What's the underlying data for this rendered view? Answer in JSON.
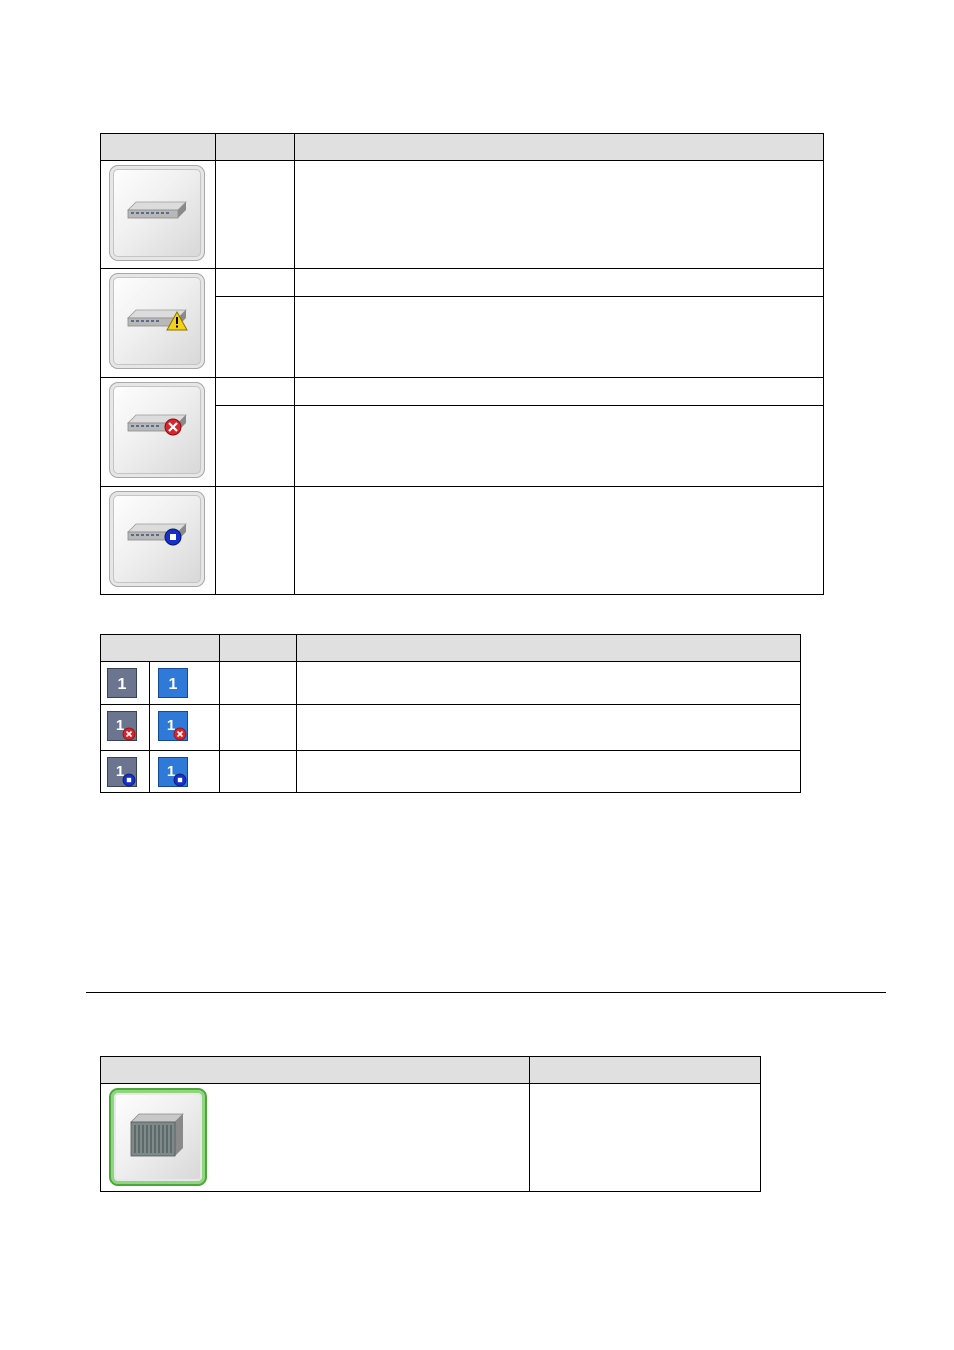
{
  "device_status_table": {
    "columns": [
      "",
      "",
      ""
    ],
    "rows": [
      {
        "icon": "switch-normal-icon",
        "status": "",
        "description": ""
      },
      {
        "icon": "switch-warning-icon",
        "status_a": "",
        "description_a": "",
        "status_b": "",
        "description_b": ""
      },
      {
        "icon": "switch-error-icon",
        "status_a": "",
        "description_a": "",
        "status_b": "",
        "description_b": ""
      },
      {
        "icon": "switch-maintenance-icon",
        "status": "",
        "description": ""
      }
    ]
  },
  "port_status_table": {
    "columns": [
      "",
      "",
      ""
    ],
    "port_label": "1",
    "rows": [
      {
        "icons": [
          "port-gray-icon",
          "port-blue-icon"
        ],
        "status": "",
        "description": ""
      },
      {
        "icons": [
          "port-gray-error-icon",
          "port-blue-error-icon"
        ],
        "status": "",
        "description": ""
      },
      {
        "icons": [
          "port-gray-maintenance-icon",
          "port-blue-maintenance-icon"
        ],
        "status": "",
        "description": ""
      }
    ]
  },
  "storage_table": {
    "columns": [
      "",
      ""
    ],
    "rows": [
      {
        "icon": "storage-array-icon",
        "description": ""
      }
    ]
  },
  "colors": {
    "header_bg": "#e0e0e0",
    "warning_yellow": "#f2d21b",
    "error_red": "#d8242b",
    "maintenance_blue": "#1530c8",
    "port_blue": "#2f7ad8",
    "port_gray": "#6b7590",
    "green_border": "#4aa83b"
  }
}
